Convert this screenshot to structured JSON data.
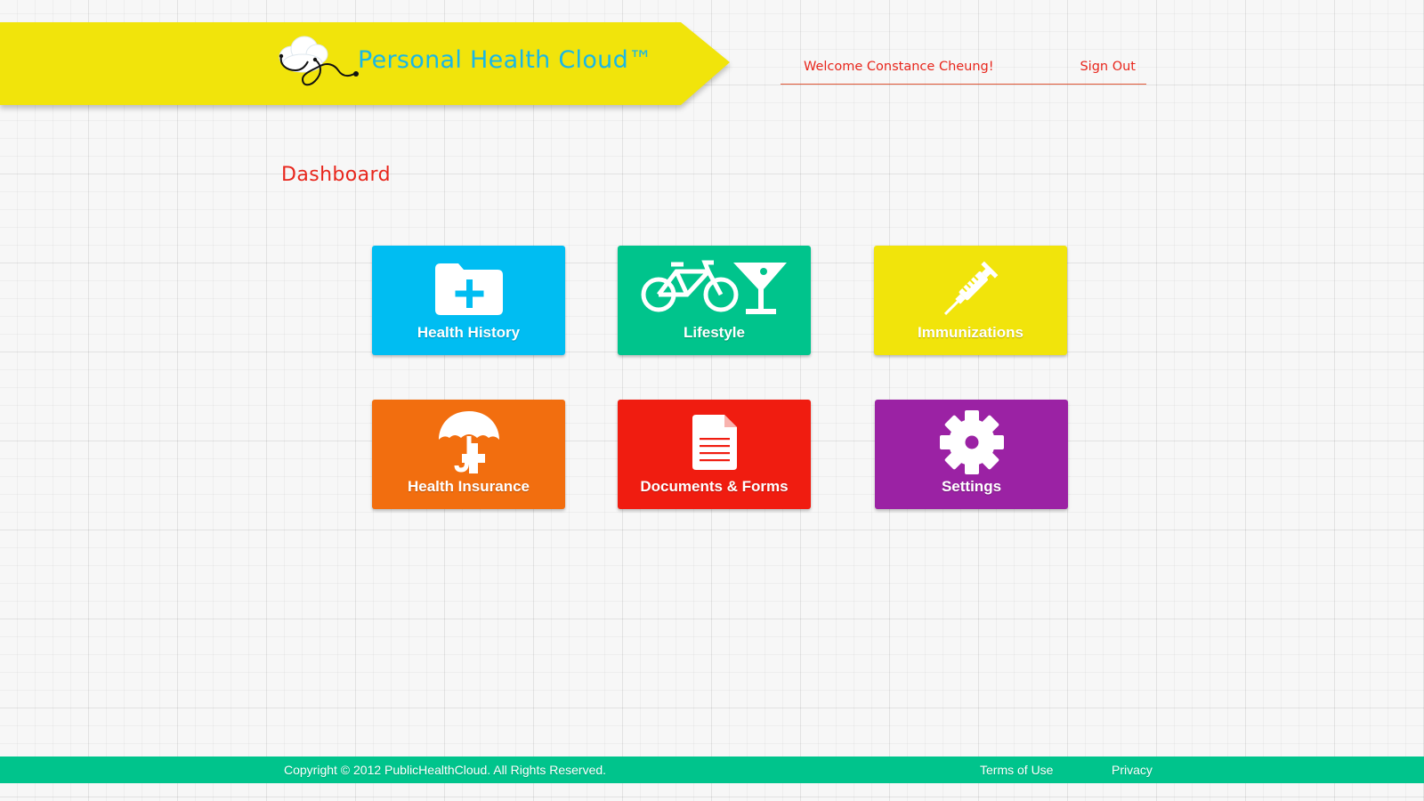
{
  "header": {
    "brand_title": "Personal Health Cloud™",
    "logo_icon": "cloud-stethoscope-icon",
    "brand_color": "#19b7e6",
    "banner_color": "#f1e40b"
  },
  "user_nav": {
    "welcome_text": "Welcome Constance Cheung!",
    "sign_out_label": "Sign Out",
    "accent_color": "#e8261c"
  },
  "page": {
    "title": "Dashboard"
  },
  "tiles": [
    {
      "label": "Health History",
      "icon": "folder-plus-icon",
      "color": "#00bdf2"
    },
    {
      "label": "Lifestyle",
      "icon": "bicycle-cocktail-icon",
      "color": "#00c48c"
    },
    {
      "label": "Immunizations",
      "icon": "syringe-icon",
      "color": "#f1e40b"
    },
    {
      "label": "Health Insurance",
      "icon": "umbrella-cross-icon",
      "color": "#f26e0f"
    },
    {
      "label": "Documents & Forms",
      "icon": "document-icon",
      "color": "#f01c10"
    },
    {
      "label": "Settings",
      "icon": "gear-icon",
      "color": "#9b22a4"
    }
  ],
  "footer": {
    "copyright": "Copyright © 2012 PublicHealthCloud. All Rights Reserved.",
    "terms_label": "Terms of Use",
    "privacy_label": "Privacy",
    "color": "#00c48c"
  }
}
